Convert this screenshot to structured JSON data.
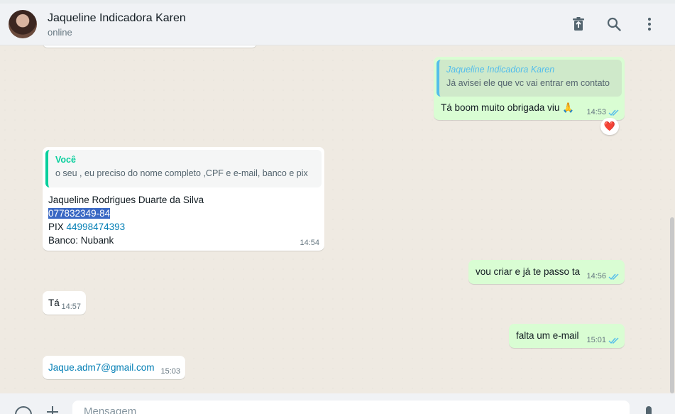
{
  "header": {
    "contact_name": "Jaqueline Indicadora Karen",
    "status": "online",
    "icons": [
      "delete-icon",
      "search-icon",
      "menu-icon"
    ]
  },
  "messages": [
    {
      "direction": "out",
      "quote_author": "Jaqueline Indicadora Karen",
      "quote_text": "Já avisei ele que vc vai entrar em contato",
      "text": "Tá boom muito obrigada viu",
      "emoji": "🙏",
      "time": "14:53",
      "reaction": "❤️"
    },
    {
      "direction": "in",
      "quote_author": "Você",
      "quote_text": "o seu , eu preciso do nome completo ,CPF e e-mail, banco e pix",
      "line1": "Jaqueline Rodrigues Duarte da Silva",
      "cpf": "077832349-84",
      "pix_label": "PIX",
      "pix_number": "44998474393",
      "bank": "Banco: Nubank",
      "time": "14:54"
    },
    {
      "direction": "out",
      "text": "vou criar e já te passo ta",
      "time": "14:56"
    },
    {
      "direction": "in",
      "text": "Tá",
      "time": "14:57"
    },
    {
      "direction": "out",
      "text": "falta um e-mail",
      "time": "15:01"
    },
    {
      "direction": "in",
      "text": "Jaque.adm7@gmail.com",
      "time": "15:03"
    }
  ],
  "footer": {
    "placeholder": "Mensagem"
  },
  "colors": {
    "outgoing_bubble": "#d9fdd3",
    "incoming_bubble": "#ffffff",
    "link": "#027eb5",
    "read_ticks": "#53bdeb",
    "quote_you": "#06cf9c",
    "quote_contact": "#53bdeb",
    "selection": "#3a68c4"
  }
}
